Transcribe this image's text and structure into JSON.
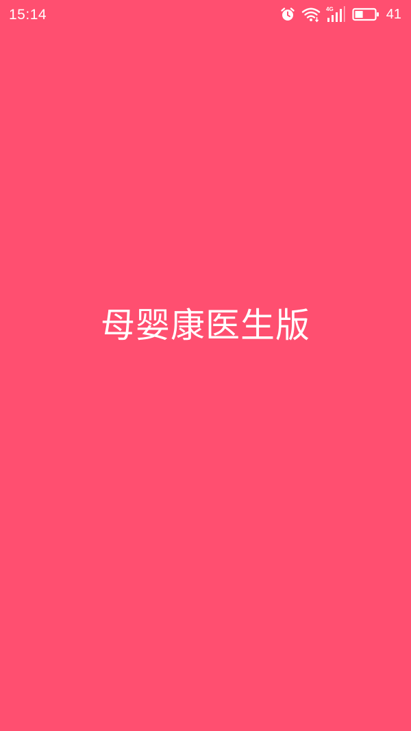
{
  "status_bar": {
    "time": "15:14",
    "network_type": "4G",
    "battery_level": "41",
    "battery_fraction": 0.41,
    "icons": [
      "alarm-icon",
      "wifi-icon",
      "cellular-signal-icon",
      "battery-icon"
    ]
  },
  "splash": {
    "title": "母婴康医生版"
  },
  "colors": {
    "background": "#FF4F70",
    "foreground": "#FFFFFF"
  }
}
